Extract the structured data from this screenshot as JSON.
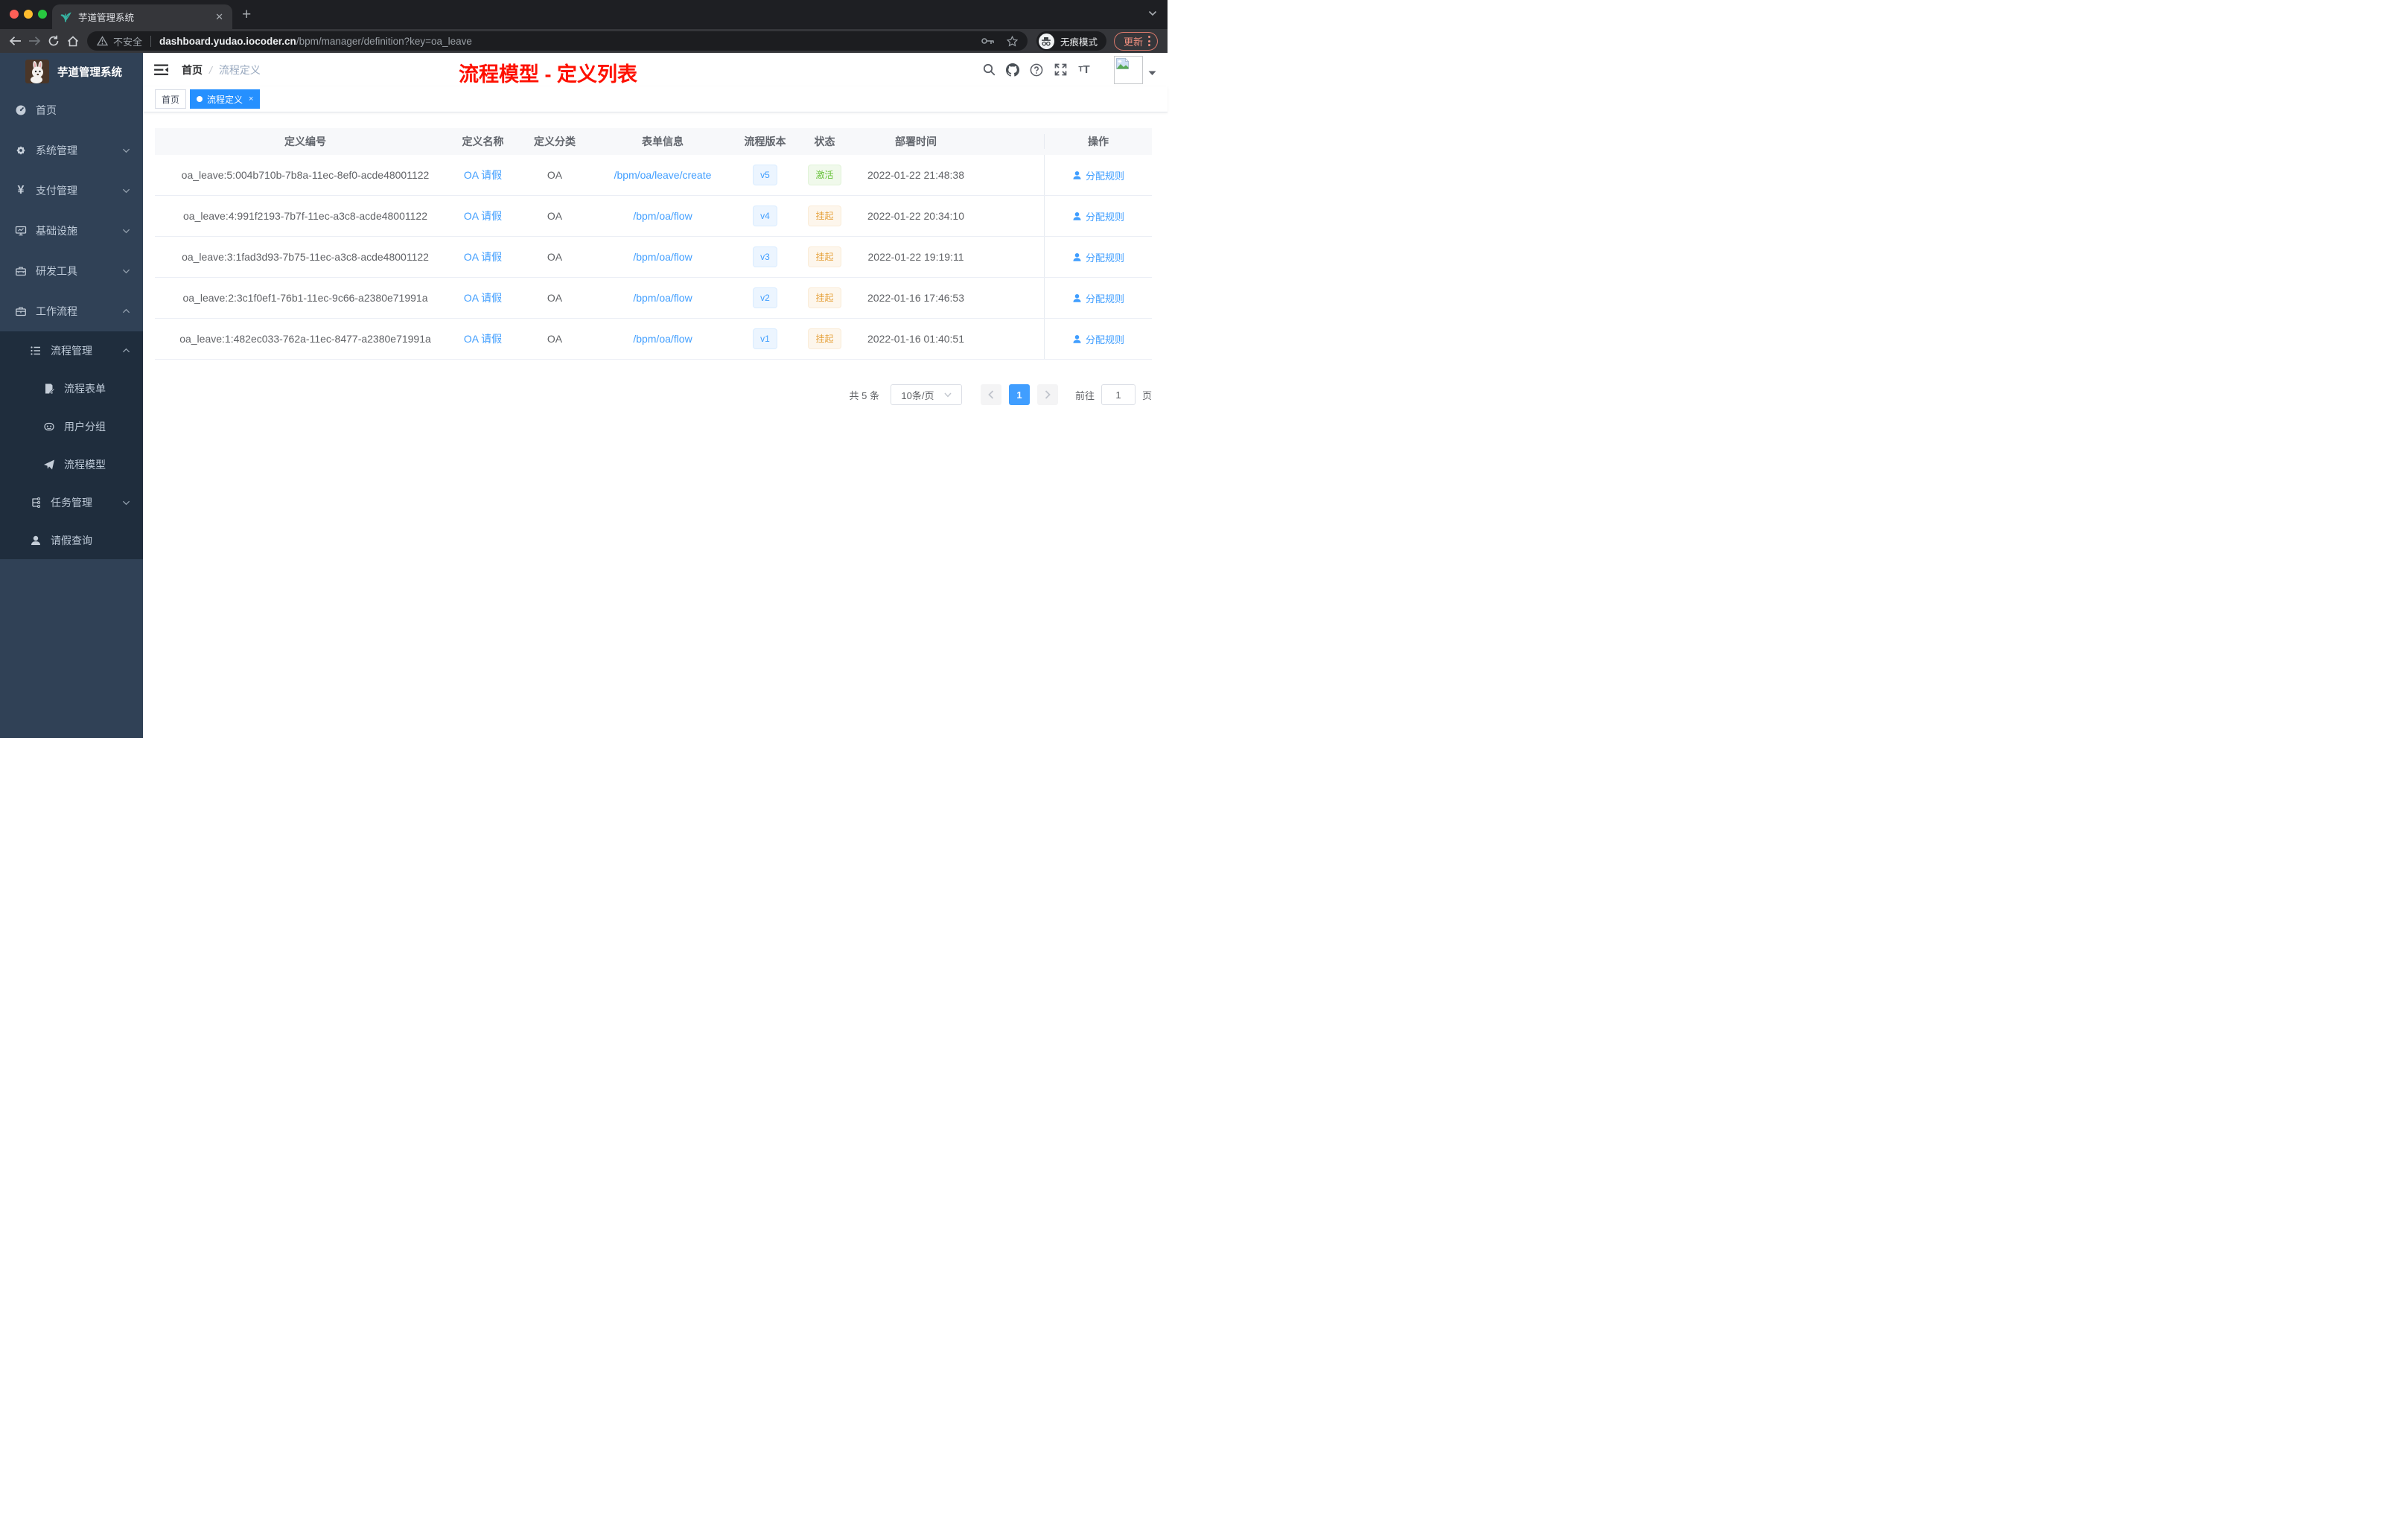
{
  "colors": {
    "accent": "#409eff",
    "tag_active_bg": "#2590ff",
    "status_active": "#67c23a",
    "status_suspended": "#e6a23c",
    "sidebar_bg": "#304156",
    "sidebar_submenu_bg": "#1f2d3d",
    "annotation_red": "#fe1000"
  },
  "browser": {
    "tab_title": "芋道管理系统",
    "security_label": "不安全",
    "url_domain": "dashboard.yudao.iocoder.cn",
    "url_path": "/bpm/manager/definition?key=oa_leave",
    "incognito_label": "无痕模式",
    "update_label": "更新",
    "new_tab_glyph": "+",
    "close_tab_glyph": "✕"
  },
  "sidebar": {
    "logo_title": "芋道管理系统",
    "menu": [
      {
        "label": "首页",
        "icon": "dashboard-icon",
        "level": 0
      },
      {
        "label": "系统管理",
        "icon": "gear-icon",
        "level": 0,
        "arrow": "down"
      },
      {
        "label": "支付管理",
        "icon": "yen-icon",
        "level": 0,
        "arrow": "down"
      },
      {
        "label": "基础设施",
        "icon": "monitor-icon",
        "level": 0,
        "arrow": "down"
      },
      {
        "label": "研发工具",
        "icon": "toolbox-icon",
        "level": 0,
        "arrow": "down"
      },
      {
        "label": "工作流程",
        "icon": "briefcase-icon",
        "level": 0,
        "arrow": "up"
      },
      {
        "label": "流程管理",
        "icon": "list-icon",
        "level": 1,
        "arrow": "up"
      },
      {
        "label": "流程表单",
        "icon": "form-icon",
        "level": 2
      },
      {
        "label": "用户分组",
        "icon": "robot-icon",
        "level": 2
      },
      {
        "label": "流程模型",
        "icon": "paper-plane-icon",
        "level": 2
      },
      {
        "label": "任务管理",
        "icon": "tree-icon",
        "level": 1,
        "arrow": "down"
      },
      {
        "label": "请假查询",
        "icon": "user-icon",
        "level": 1
      }
    ]
  },
  "navbar": {
    "breadcrumb_home": "首页",
    "breadcrumb_separator": "/",
    "breadcrumb_current": "流程定义"
  },
  "annotation": "流程模型 - 定义列表",
  "tags": {
    "home": "首页",
    "active": "流程定义"
  },
  "table": {
    "columns": [
      "定义编号",
      "定义名称",
      "定义分类",
      "表单信息",
      "流程版本",
      "状态",
      "部署时间",
      "操作"
    ],
    "rows": [
      {
        "id": "oa_leave:5:004b710b-7b8a-11ec-8ef0-acde48001122",
        "name": "OA 请假",
        "category": "OA",
        "form": "/bpm/oa/leave/create",
        "version": "v5",
        "status": "激活",
        "time": "2022-01-22 21:48:38",
        "action": "分配规则"
      },
      {
        "id": "oa_leave:4:991f2193-7b7f-11ec-a3c8-acde48001122",
        "name": "OA 请假",
        "category": "OA",
        "form": "/bpm/oa/flow",
        "version": "v4",
        "status": "挂起",
        "time": "2022-01-22 20:34:10",
        "action": "分配规则"
      },
      {
        "id": "oa_leave:3:1fad3d93-7b75-11ec-a3c8-acde48001122",
        "name": "OA 请假",
        "category": "OA",
        "form": "/bpm/oa/flow",
        "version": "v3",
        "status": "挂起",
        "time": "2022-01-22 19:19:11",
        "action": "分配规则"
      },
      {
        "id": "oa_leave:2:3c1f0ef1-76b1-11ec-9c66-a2380e71991a",
        "name": "OA 请假",
        "category": "OA",
        "form": "/bpm/oa/flow",
        "version": "v2",
        "status": "挂起",
        "time": "2022-01-16 17:46:53",
        "action": "分配规则"
      },
      {
        "id": "oa_leave:1:482ec033-762a-11ec-8477-a2380e71991a",
        "name": "OA 请假",
        "category": "OA",
        "form": "/bpm/oa/flow",
        "version": "v1",
        "status": "挂起",
        "time": "2022-01-16 01:40:51",
        "action": "分配规则"
      }
    ]
  },
  "pagination": {
    "total": "共 5 条",
    "page_size": "10条/页",
    "current": "1",
    "goto_label": "前往",
    "goto_value": "1",
    "page_unit": "页"
  }
}
